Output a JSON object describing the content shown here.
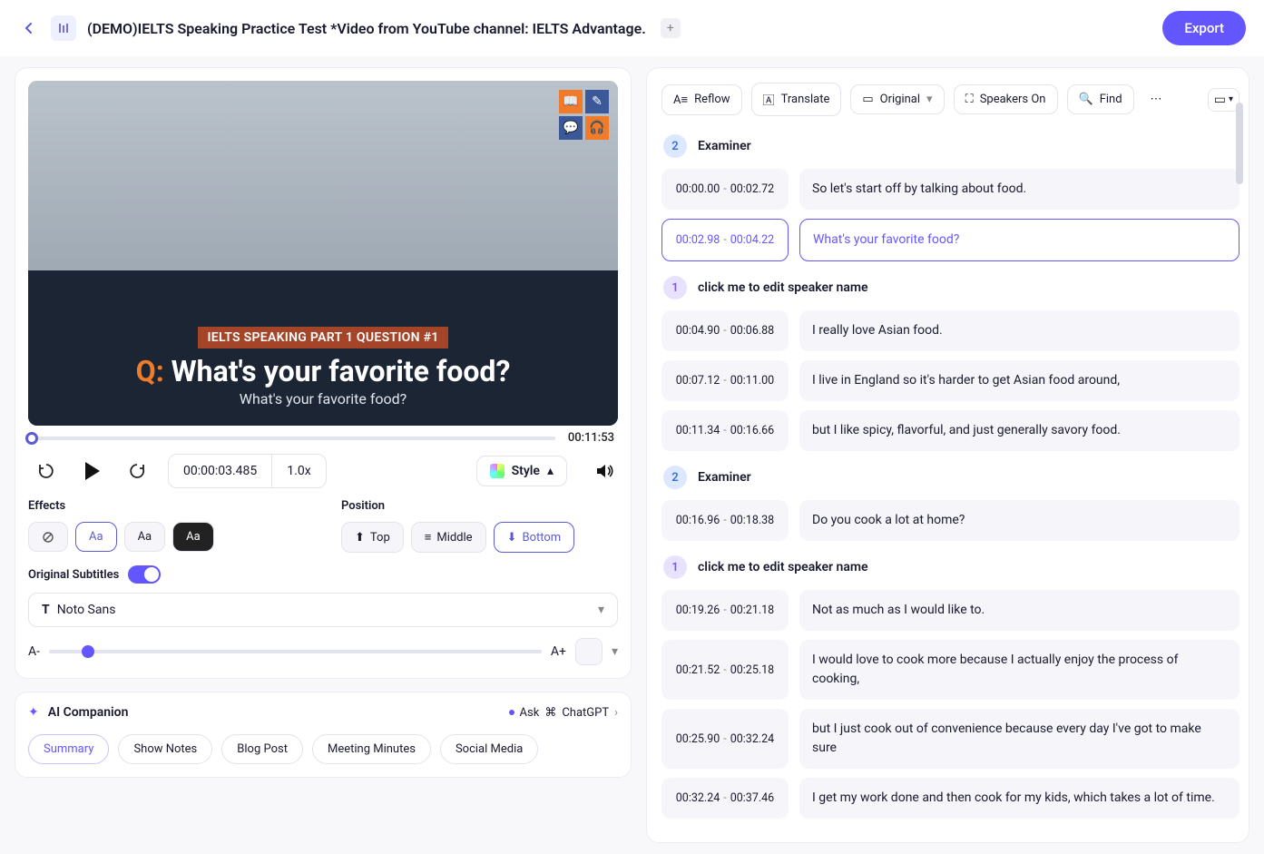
{
  "header": {
    "title": "(DEMO)IELTS Speaking Practice Test *Video from YouTube channel: IELTS Advantage.",
    "export_label": "Export"
  },
  "video": {
    "tag": "IELTS SPEAKING PART 1 QUESTION #1",
    "q_prefix": "Q:",
    "question": "What's your favorite food?",
    "subtitle": "What's your favorite food?",
    "duration": "00:11:53",
    "current_time": "00:00:03.485",
    "speed": "1.0x",
    "style_label": "Style"
  },
  "effects": {
    "label": "Effects",
    "position_label": "Position",
    "pos_top": "Top",
    "pos_middle": "Middle",
    "pos_bottom": "Bottom",
    "orig_sub_label": "Original Subtitles",
    "font": "Noto Sans",
    "a_minus": "A-",
    "a_plus": "A+",
    "aa1": "Aa",
    "aa2": "Aa",
    "aa3": "Aa"
  },
  "ai": {
    "title": "AI Companion",
    "ask": "Ask",
    "gpt": "ChatGPT",
    "pills": [
      "Summary",
      "Show Notes",
      "Blog Post",
      "Meeting Minutes",
      "Social Media"
    ]
  },
  "toolbar": {
    "reflow": "Reflow",
    "translate": "Translate",
    "original": "Original",
    "speakers": "Speakers On",
    "find": "Find"
  },
  "speakers": {
    "examiner": "Examiner",
    "edit_prompt": "click me to edit speaker name"
  },
  "transcript": [
    {
      "speaker": 2,
      "name_key": "examiner",
      "rows": [
        {
          "t": "00:00.00 - 00:02.72",
          "txt": "So let's start off by talking about food."
        },
        {
          "t": "00:02.98 - 00:04.22",
          "txt": "What's your favorite food?",
          "active": true
        }
      ]
    },
    {
      "speaker": 1,
      "name_key": "edit_prompt",
      "rows": [
        {
          "t": "00:04.90 - 00:06.88",
          "txt": "I really love Asian food."
        },
        {
          "t": "00:07.12 - 00:11.00",
          "txt": "I live in England so it's harder to get Asian food around,"
        },
        {
          "t": "00:11.34 - 00:16.66",
          "txt": "but I like spicy, flavorful, and just generally savory food."
        }
      ]
    },
    {
      "speaker": 2,
      "name_key": "examiner",
      "rows": [
        {
          "t": "00:16.96 - 00:18.38",
          "txt": "Do you cook a lot at home?"
        }
      ]
    },
    {
      "speaker": 1,
      "name_key": "edit_prompt",
      "rows": [
        {
          "t": "00:19.26 - 00:21.18",
          "txt": "Not as much as I would like to."
        },
        {
          "t": "00:21.52 - 00:25.18",
          "txt": "I would love to cook more because I actually enjoy the process of cooking,"
        },
        {
          "t": "00:25.90 - 00:32.24",
          "txt": "but I just cook out of convenience because every day I've got to make sure"
        },
        {
          "t": "00:32.24 - 00:37.46",
          "txt": "I get my work done and then cook for my kids, which takes a lot of time."
        }
      ]
    }
  ]
}
